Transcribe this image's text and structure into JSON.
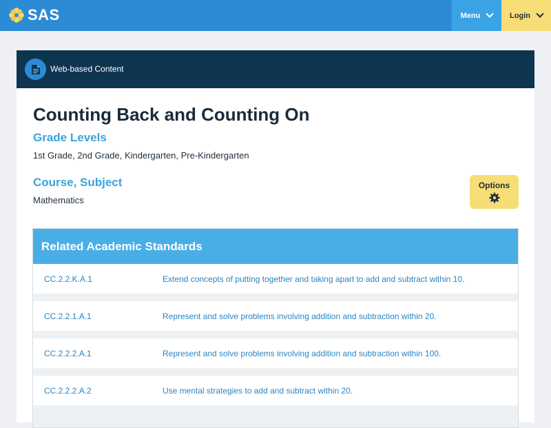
{
  "header": {
    "logo_text": "SAS",
    "menu_label": "Menu",
    "login_label": "Login"
  },
  "card": {
    "type_label": "Web-based Content",
    "title": "Counting Back and Counting On",
    "grade_levels_heading": "Grade Levels",
    "grade_levels_value": "1st Grade, 2nd Grade, Kindergarten, Pre-Kindergarten",
    "course_heading": "Course, Subject",
    "course_value": "Mathematics",
    "options_label": "Options"
  },
  "standards": {
    "heading": "Related Academic Standards",
    "rows": [
      {
        "code": "CC.2.2.K.A.1",
        "description": "Extend concepts of putting together and taking apart to add and subtract within 10."
      },
      {
        "code": "CC.2.2.1.A.1",
        "description": "Represent and solve problems involving addition and subtraction within 20."
      },
      {
        "code": "CC.2.2.2.A.1",
        "description": "Represent and solve problems involving addition and subtraction within 100."
      },
      {
        "code": "CC.2.2.2.A.2",
        "description": "Use mental strategies to add and subtract within 20."
      }
    ]
  },
  "colors": {
    "topbar": "#2d8bd6",
    "menu": "#3aa3e6",
    "login": "#f7dd76",
    "card_header": "#0e3550",
    "accent": "#3aa3db"
  }
}
